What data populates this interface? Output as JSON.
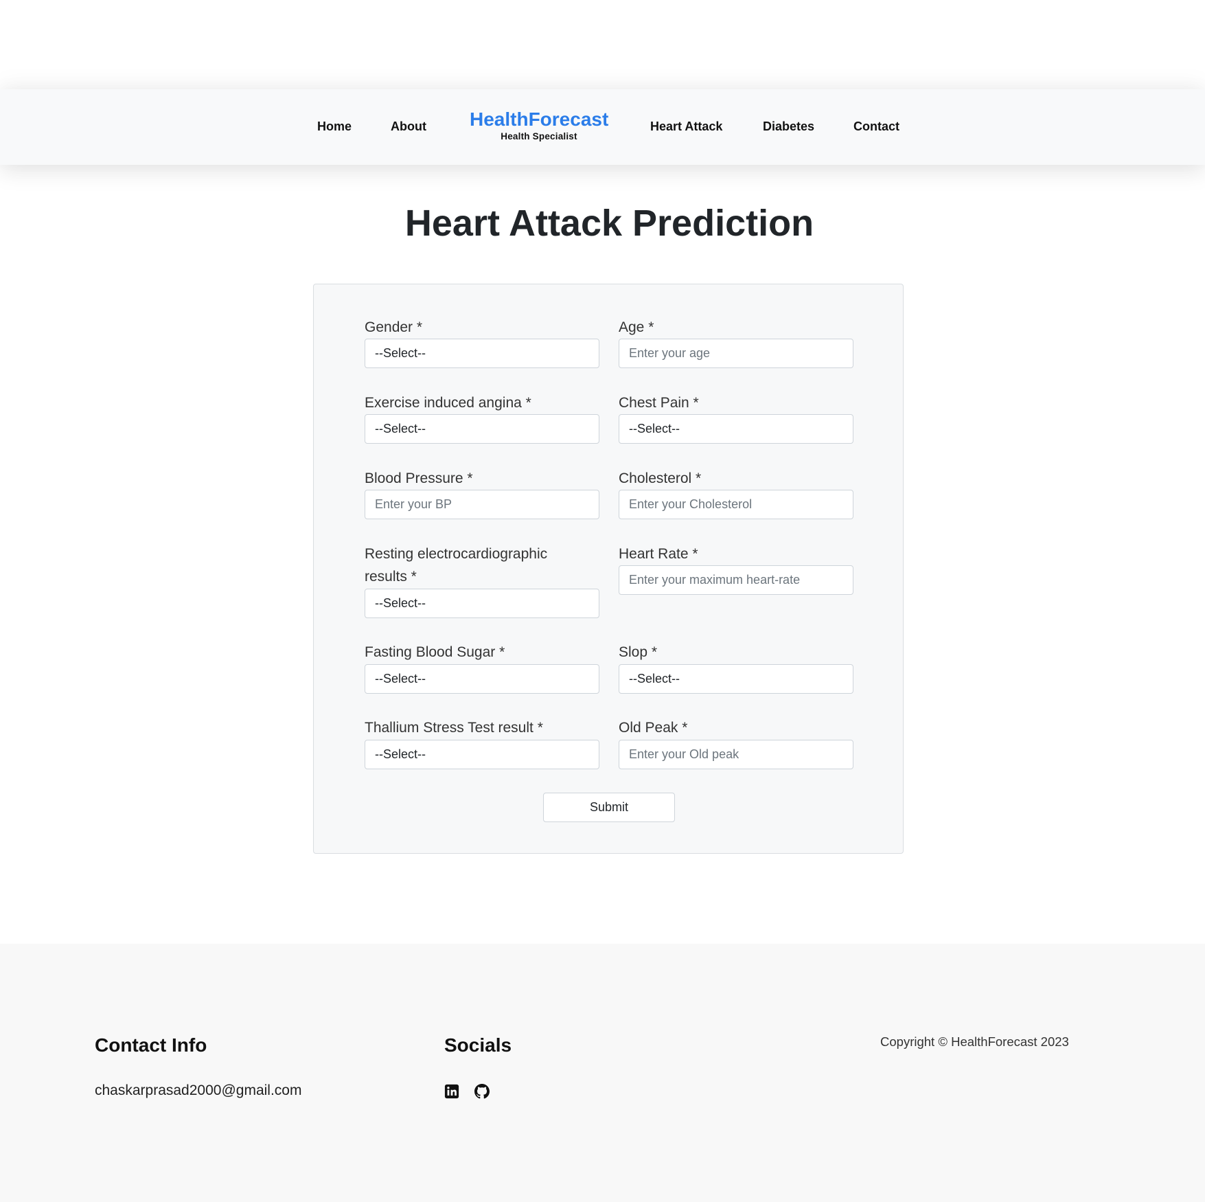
{
  "nav": {
    "home": "Home",
    "about": "About",
    "brand_name": "HealthForecast",
    "brand_tagline": "Health Specialist",
    "heart_attack": "Heart Attack",
    "diabetes": "Diabetes",
    "contact": "Contact"
  },
  "page_title": "Heart Attack Prediction",
  "form": {
    "gender": {
      "label": "Gender *",
      "value": "--Select--"
    },
    "age": {
      "label": "Age *",
      "placeholder": "Enter your age"
    },
    "angina": {
      "label": "Exercise induced angina *",
      "value": "--Select--"
    },
    "chest_pain": {
      "label": "Chest Pain *",
      "value": "--Select--"
    },
    "blood_pressure": {
      "label": "Blood Pressure *",
      "placeholder": "Enter your BP"
    },
    "cholesterol": {
      "label": "Cholesterol *",
      "placeholder": "Enter your Cholesterol"
    },
    "ecg": {
      "label_line1": "Resting electrocardiographic",
      "label_line2": "results *",
      "value": "--Select--"
    },
    "heart_rate": {
      "label": "Heart Rate *",
      "placeholder": "Enter your maximum heart-rate"
    },
    "fasting_sugar": {
      "label": "Fasting Blood Sugar *",
      "value": "--Select--"
    },
    "slop": {
      "label": "Slop *",
      "value": "--Select--"
    },
    "thallium": {
      "label": "Thallium Stress Test result *",
      "value": "--Select--"
    },
    "old_peak": {
      "label": "Old Peak *",
      "placeholder": "Enter your Old peak"
    },
    "submit_label": "Submit"
  },
  "footer": {
    "contact_heading": "Contact Info",
    "email": "chaskarprasad2000@gmail.com",
    "socials_heading": "Socials",
    "social_icons": [
      "linkedin-icon",
      "github-icon"
    ],
    "copyright": "Copyright © HealthForecast 2023"
  },
  "colors": {
    "brand": "#2b7de9",
    "header_bg": "#f8f9fa",
    "card_bg": "#f7f8f9",
    "footer_bg": "#f8f8f8",
    "text": "#212529"
  }
}
